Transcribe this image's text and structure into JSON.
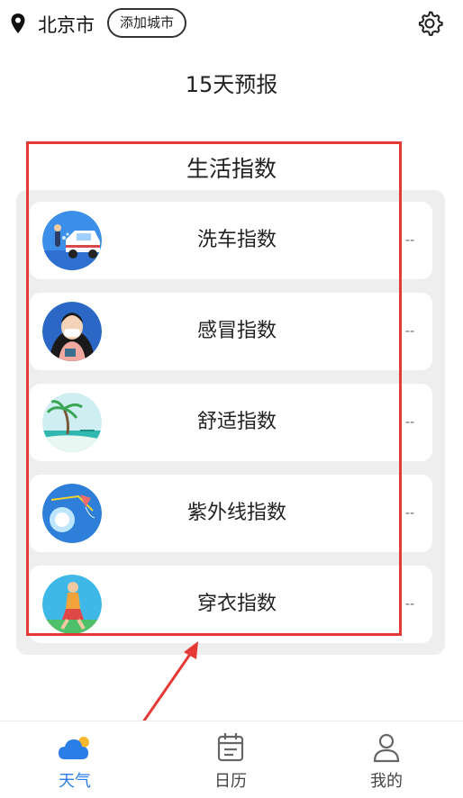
{
  "header": {
    "city": "北京市",
    "add_city_label": "添加城市",
    "location_icon": "location-pin-icon",
    "settings_icon": "gear-icon"
  },
  "forecast_title": "15天预报",
  "life_index": {
    "title": "生活指数",
    "items": [
      {
        "label": "洗车指数",
        "value": "--",
        "icon": "car-wash-icon"
      },
      {
        "label": "感冒指数",
        "value": "--",
        "icon": "cold-mask-icon"
      },
      {
        "label": "舒适指数",
        "value": "--",
        "icon": "beach-palm-icon"
      },
      {
        "label": "紫外线指数",
        "value": "--",
        "icon": "sun-uv-icon"
      },
      {
        "label": "穿衣指数",
        "value": "--",
        "icon": "clothing-walker-icon"
      }
    ]
  },
  "tabbar": {
    "tabs": [
      {
        "label": "天气",
        "icon": "cloud-sun-icon",
        "active": true
      },
      {
        "label": "日历",
        "icon": "calendar-icon",
        "active": false
      },
      {
        "label": "我的",
        "icon": "user-icon",
        "active": false
      }
    ],
    "active_color": "#2a7ee6"
  },
  "colors": {
    "annotation": "#e53935",
    "panel_bg": "#eeeeee"
  }
}
